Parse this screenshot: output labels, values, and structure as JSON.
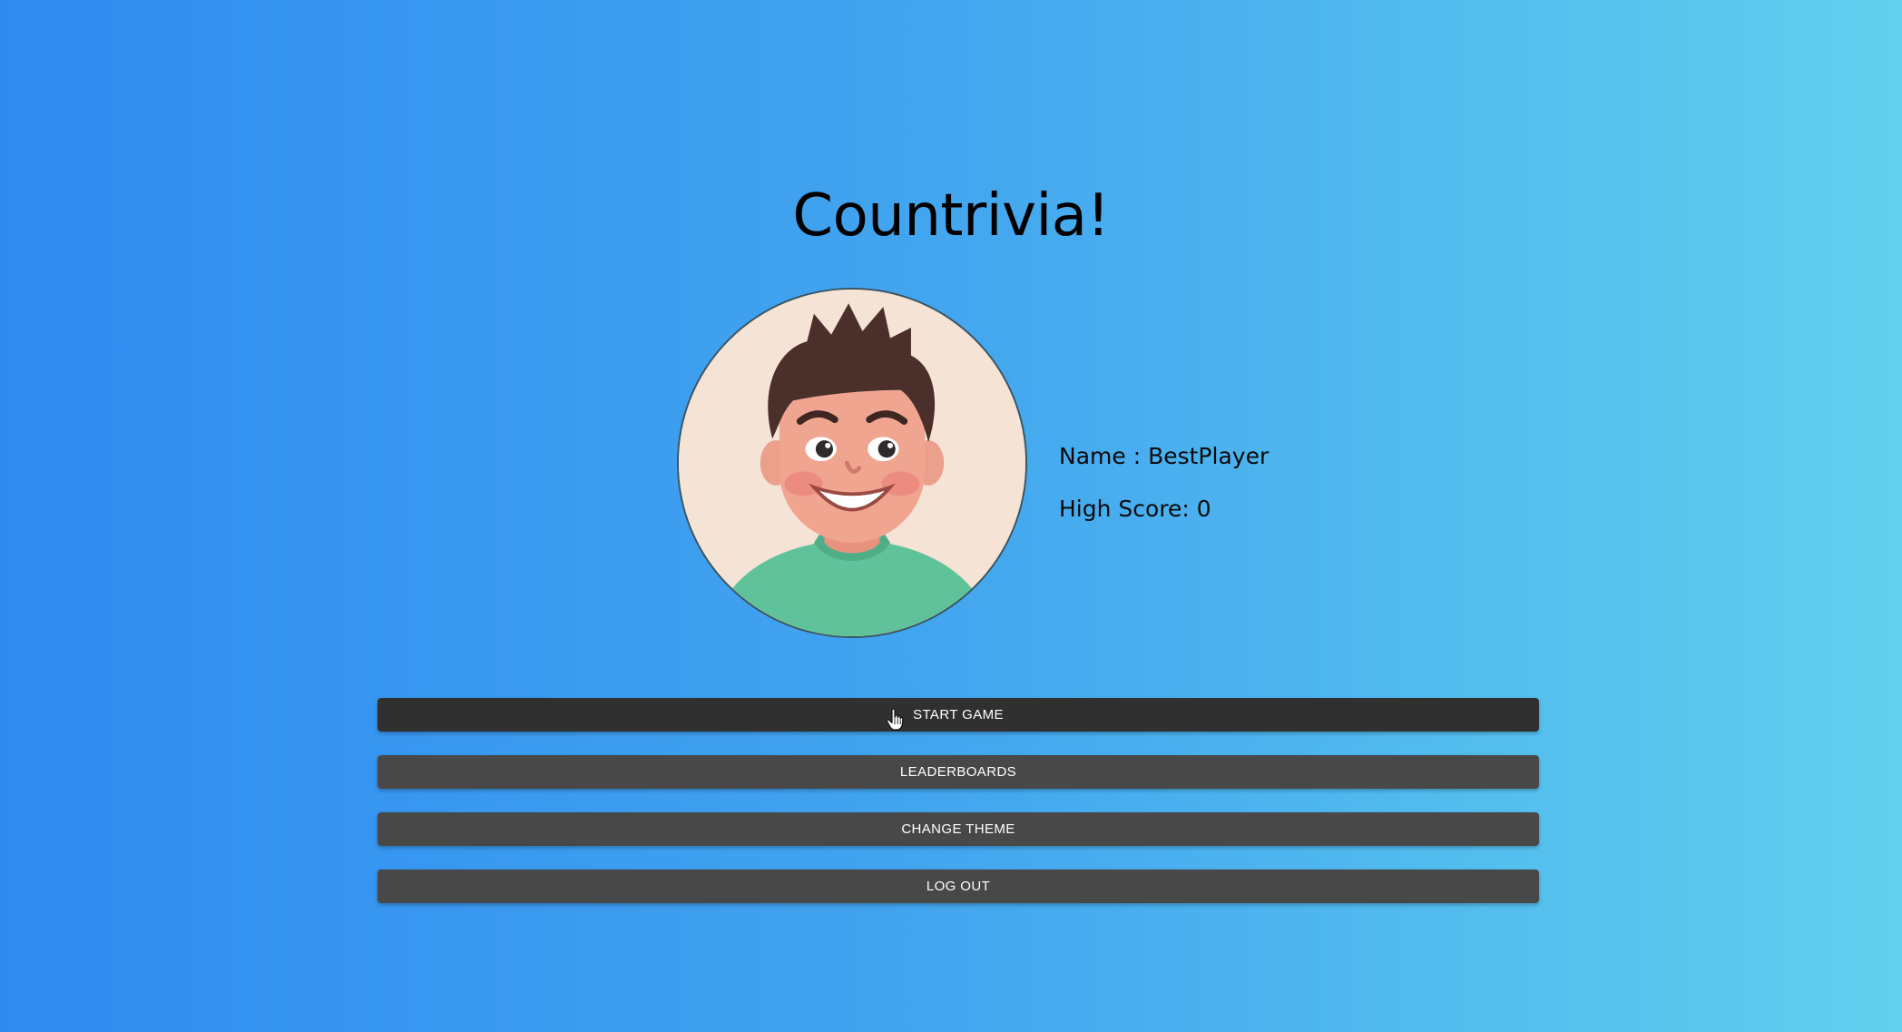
{
  "title": "Countrivia!",
  "profile": {
    "name_line": "Name : BestPlayer",
    "high_score_line": "High Score: 0",
    "avatar_icon": "smiling-boy-avatar"
  },
  "menu": {
    "buttons": [
      {
        "label": "START GAME",
        "state": "hovered"
      },
      {
        "label": "LEADERBOARDS"
      },
      {
        "label": "CHANGE THEME"
      },
      {
        "label": "LOG OUT"
      }
    ]
  },
  "colors": {
    "background_start": "#2f8bf0",
    "background_end": "#60d0ee",
    "button": "#484848",
    "button_hover": "#303030",
    "button_text": "#ffffff"
  },
  "cursor_icon": "hand-pointer-icon"
}
